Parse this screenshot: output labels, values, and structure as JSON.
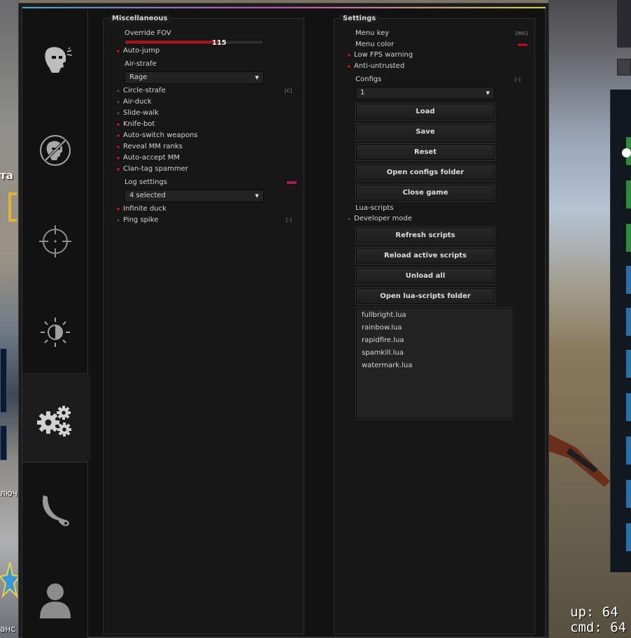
{
  "background": {
    "left_text_1": "та",
    "left_text_2": "лючи",
    "left_text_3": "анс",
    "console": {
      "line_1": "up: 64",
      "line_2": "cmd: 64"
    }
  },
  "tabs": [
    {
      "name": "rage",
      "icon": "masked-head-icon"
    },
    {
      "name": "anti-aim",
      "icon": "crossed-head-icon"
    },
    {
      "name": "legit",
      "icon": "crosshair-icon"
    },
    {
      "name": "visuals",
      "icon": "brightness-icon"
    },
    {
      "name": "misc",
      "icon": "gears-icon",
      "active": true
    },
    {
      "name": "skins",
      "icon": "karambit-icon"
    },
    {
      "name": "players",
      "icon": "user-icon"
    }
  ],
  "misc": {
    "title": "Miscellaneous",
    "override_fov": {
      "label": "Override FOV",
      "value": 115,
      "value_text": "115",
      "fill": 0.69
    },
    "auto_jump": {
      "label": "Auto-jump",
      "checked": true
    },
    "air_strafe": {
      "label": "Air-strafe",
      "value": "Rage"
    },
    "circle_strafe": {
      "label": "Circle-strafe",
      "checked": false,
      "key": "[C]"
    },
    "air_duck": {
      "label": "Air-duck",
      "checked": false
    },
    "slide_walk": {
      "label": "Slide-walk",
      "checked": false
    },
    "knife_bot": {
      "label": "Knife-bot",
      "checked": true
    },
    "auto_switch": {
      "label": "Auto-switch weapons",
      "checked": true
    },
    "reveal_mm": {
      "label": "Reveal MM ranks",
      "checked": true
    },
    "auto_accept": {
      "label": "Auto-accept MM",
      "checked": true
    },
    "clan_tag": {
      "label": "Clan-tag spammer",
      "checked": true
    },
    "log_settings": {
      "label": "Log settings",
      "value": "4 selected",
      "color": "#b0185a"
    },
    "infinite_duck": {
      "label": "Infinite duck",
      "checked": true
    },
    "ping_spike": {
      "label": "Ping spike",
      "checked": false,
      "key": "[-]"
    }
  },
  "settings": {
    "title": "Settings",
    "menu_key": {
      "label": "Menu key",
      "key": "[INS]"
    },
    "menu_color": {
      "label": "Menu color",
      "color": "#9f1521"
    },
    "low_fps": {
      "label": "Low FPS warning",
      "checked": true
    },
    "anti_untrusted": {
      "label": "Anti-untrusted",
      "checked": true
    },
    "configs": {
      "label": "Configs",
      "key": "[-]",
      "value": "1"
    },
    "buttons": {
      "load": "Load",
      "save": "Save",
      "reset": "Reset",
      "open_configs": "Open configs folder",
      "close_game": "Close game"
    },
    "lua_scripts": {
      "label": "Lua-scripts"
    },
    "developer_mode": {
      "label": "Developer mode",
      "checked": false
    },
    "lua_buttons": {
      "refresh": "Refresh scripts",
      "reload": "Reload active scripts",
      "unload": "Unload all",
      "open_folder": "Open lua-scripts folder"
    },
    "scripts": [
      "fullbright.lua",
      "rainbow.lua",
      "rapidfire.lua",
      "spamkill.lua",
      "watermark.lua"
    ]
  }
}
